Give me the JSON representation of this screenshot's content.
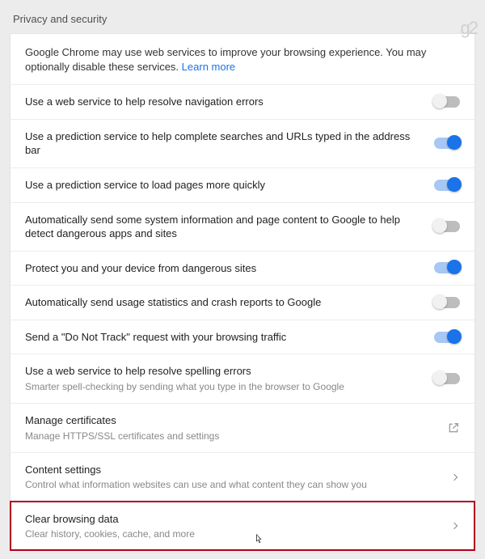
{
  "section": {
    "title": "Privacy and security"
  },
  "intro": {
    "text": "Google Chrome may use web services to improve your browsing experience. You may optionally disable these services. ",
    "link": "Learn more"
  },
  "rows": [
    {
      "label": "Use a web service to help resolve navigation errors",
      "kind": "toggle",
      "on": false
    },
    {
      "label": "Use a prediction service to help complete searches and URLs typed in the address bar",
      "kind": "toggle",
      "on": true
    },
    {
      "label": "Use a prediction service to load pages more quickly",
      "kind": "toggle",
      "on": true
    },
    {
      "label": "Automatically send some system information and page content to Google to help detect dangerous apps and sites",
      "kind": "toggle",
      "on": false
    },
    {
      "label": "Protect you and your device from dangerous sites",
      "kind": "toggle",
      "on": true
    },
    {
      "label": "Automatically send usage statistics and crash reports to Google",
      "kind": "toggle",
      "on": false
    },
    {
      "label": "Send a \"Do Not Track\" request with your browsing traffic",
      "kind": "toggle",
      "on": true
    },
    {
      "label": "Use a web service to help resolve spelling errors",
      "sub": "Smarter spell-checking by sending what you type in the browser to Google",
      "kind": "toggle",
      "on": false
    },
    {
      "label": "Manage certificates",
      "sub": "Manage HTTPS/SSL certificates and settings",
      "kind": "external"
    },
    {
      "label": "Content settings",
      "sub": "Control what information websites can use and what content they can show you",
      "kind": "nav"
    },
    {
      "label": "Clear browsing data",
      "sub": "Clear history, cookies, cache, and more",
      "kind": "nav",
      "highlight": true,
      "cursor": true
    }
  ],
  "watermark": "g2"
}
